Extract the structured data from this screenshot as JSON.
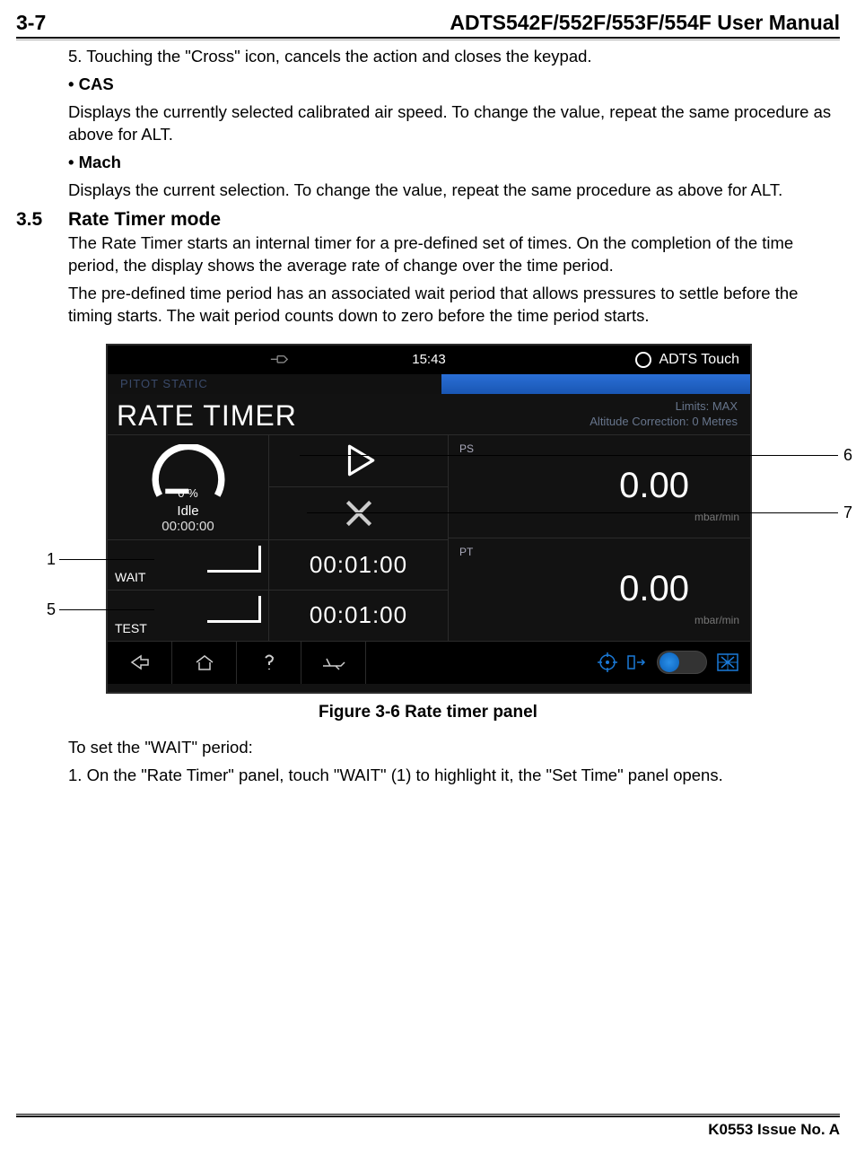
{
  "header": {
    "page_num": "3-7",
    "manual_title": "ADTS542F/552F/553F/554F User Manual"
  },
  "text": {
    "line5": "5. Touching the \"Cross\" icon, cancels the action and closes the keypad.",
    "cas_head": "• CAS",
    "cas_body": "Displays the currently selected calibrated air speed. To change the value, repeat the same procedure as above for ALT.",
    "mach_head": "• Mach",
    "mach_body": "Displays the current selection. To change the value, repeat the same procedure as above for ALT."
  },
  "section": {
    "num": "3.5",
    "title": "Rate Timer mode",
    "p1": "The Rate Timer starts an internal timer for a pre-defined set of times. On the completion of the time period, the display shows the average rate of change over the time period.",
    "p2": "The pre-defined time period has an associated wait period that allows pressures to settle before the timing starts. The wait period counts down to zero before the time period starts."
  },
  "device": {
    "clock": "15:43",
    "brand": "ADTS Touch",
    "tab_label": "PITOT STATIC",
    "screen_title": "RATE TIMER",
    "limits_line1": "Limits: MAX",
    "limits_line2": "Altitude Correction: 0 Metres",
    "gauge_pct": "0 %",
    "idle_label": "Idle",
    "idle_time": "00:00:00",
    "wait_label": "WAIT",
    "test_label": "TEST",
    "wait_time": "00:01:00",
    "test_time": "00:01:00",
    "ps_label": "PS",
    "pt_label": "PT",
    "ps_value": "0.00",
    "pt_value": "0.00",
    "unit": "mbar/min"
  },
  "callouts": {
    "c1": "1",
    "c5": "5",
    "c6": "6",
    "c7": "7"
  },
  "figure_caption": "Figure 3-6 Rate timer panel",
  "after_fig": {
    "p1": "To set the \"WAIT\" period:",
    "p2": "1. On the \"Rate Timer\" panel, touch \"WAIT\" (1) to highlight it, the \"Set Time\" panel opens."
  },
  "footer": {
    "issue": "K0553 Issue No. A"
  }
}
